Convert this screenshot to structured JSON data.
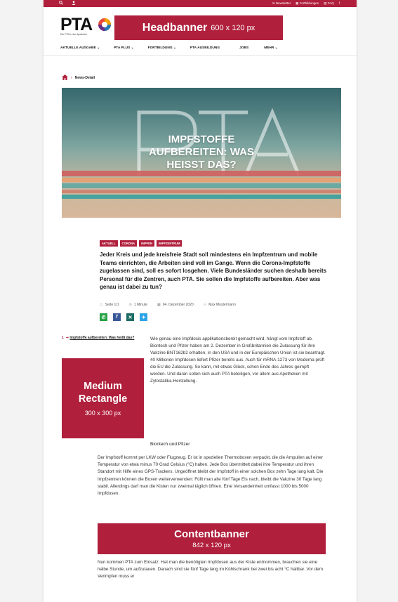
{
  "topbar": {
    "icons": [
      "search-icon",
      "user-icon"
    ],
    "links": [
      "Newsletter",
      "Fortbildungen",
      "FAQ"
    ],
    "facebook": "f"
  },
  "logo": {
    "text": "PTA",
    "subtitle": "Die PTA in der Apotheke"
  },
  "headbanner": {
    "title": "Headbanner",
    "size": "600 x 120 px"
  },
  "nav": [
    "AKTUELLE AUSGABE",
    "PTA PLUS",
    "FORTBILDUNG",
    "PTA AUSBILDUNG",
    "JOBS",
    "MEHR"
  ],
  "breadcrumb": {
    "current": "News-Detail"
  },
  "hero": {
    "title_lines": [
      "IMPFSTOFFE",
      "AUFBEREITEN: WAS",
      "HEISST DAS?"
    ],
    "logo_text": "PTA"
  },
  "tags": [
    "AKTUELL",
    "CORONA",
    "IMPFEN",
    "IMPFZENTRUM"
  ],
  "lead": "Jeder Kreis und jede kreisfreie Stadt soll mindestens ein Impfzentrum und mobile Teams einrichten, die Arbeiten sind voll im Gange. Wenn die Corona-Impfstoffe zugelassen sind, soll es sofort losgehen. Viele Bundesländer suchen deshalb bereits Personal für die Zentren, auch PTA. Sie sollen die Impfstoffe aufbereiten. Aber was genau ist dabei zu tun?",
  "meta": {
    "pages": "Seite 1/1",
    "reading_time": "1 Minute",
    "date": "04. Dezember 2020",
    "author": "Max Mustermann"
  },
  "share": {
    "buttons": [
      {
        "name": "whatsapp",
        "glyph": "✆",
        "color": "#25a244"
      },
      {
        "name": "facebook",
        "glyph": "f",
        "color": "#3b5998"
      },
      {
        "name": "xing",
        "glyph": "✕",
        "color": "#1c6b63"
      },
      {
        "name": "twitter",
        "glyph": "✦",
        "color": "#2ea4e8"
      }
    ]
  },
  "related": {
    "number": "1",
    "title": "Impfstoffe aufbereiten: Was heißt das?"
  },
  "medium_rectangle": {
    "title_lines": [
      "Medium",
      "Rectangle"
    ],
    "size": "300 x 300 px"
  },
  "paragraph1": "Wie genau eine Impfdosis applikationsbereit gemacht wird, hängt vom Impfstoff ab. Biontech und Pfizer haben am 2. Dezember in Großbritannien die Zulassung für ihre Vakzine BNT162b2 erhalten, in den USA und in der Europäischen Union ist sie beantragt. 40 Millionen Impfdosen liefert Pfizer bereits aus. Auch für mRNA-1273 von Moderna prüft die EU die Zulassung. So kann, mit etwas Glück, schon Ende des Jahres geimpft werden. Und daran sollen sich auch PTA beteiligen, vor allem aus Apotheken mit Zytostatika-Herstellung.",
  "subheading": "Biontech und Pfizer",
  "paragraph2": "Der Impfstoff kommt per LKW oder Flugzeug. Er ist in speziellen Thermoboxen verpackt, die die Ampullen auf einer Temperatur von etwa minus 70 Grad Celsius (°C) halten. Jede Box übermittelt dabei ihre Temperatur und ihren Standort mit Hilfe eines GPS-Trackers. Ungeöffnet bleibt der Impfstoff in einer solchen Box zehn Tage lang kalt. Die Impfzentren können die Boxen weiterverwenden: Füllt man alle fünf Tage Eis nach, bleibt die Vakzine 30 Tage lang stabil. Allerdings darf man die Kisten nur zweimal täglich öffnen. Eine Versandeinheit umfasst 1000 bis 5000 Impfdosen.",
  "content_banner": {
    "title": "Contentbanner",
    "size": "842 x 120 px"
  },
  "paragraph3": "Nun kommen PTA zum Einsatz: Hat man die benötigten Impfdosen aus der Kiste entnommen, brauchen sie eine halbe Stunde, um aufzutauen. Danach sind sie fünf Tage lang im Kühlschrank bei zwei bis acht °C haltbar. Vor dem Verimpfen muss er",
  "colors": {
    "brand": "#b01f3c"
  }
}
